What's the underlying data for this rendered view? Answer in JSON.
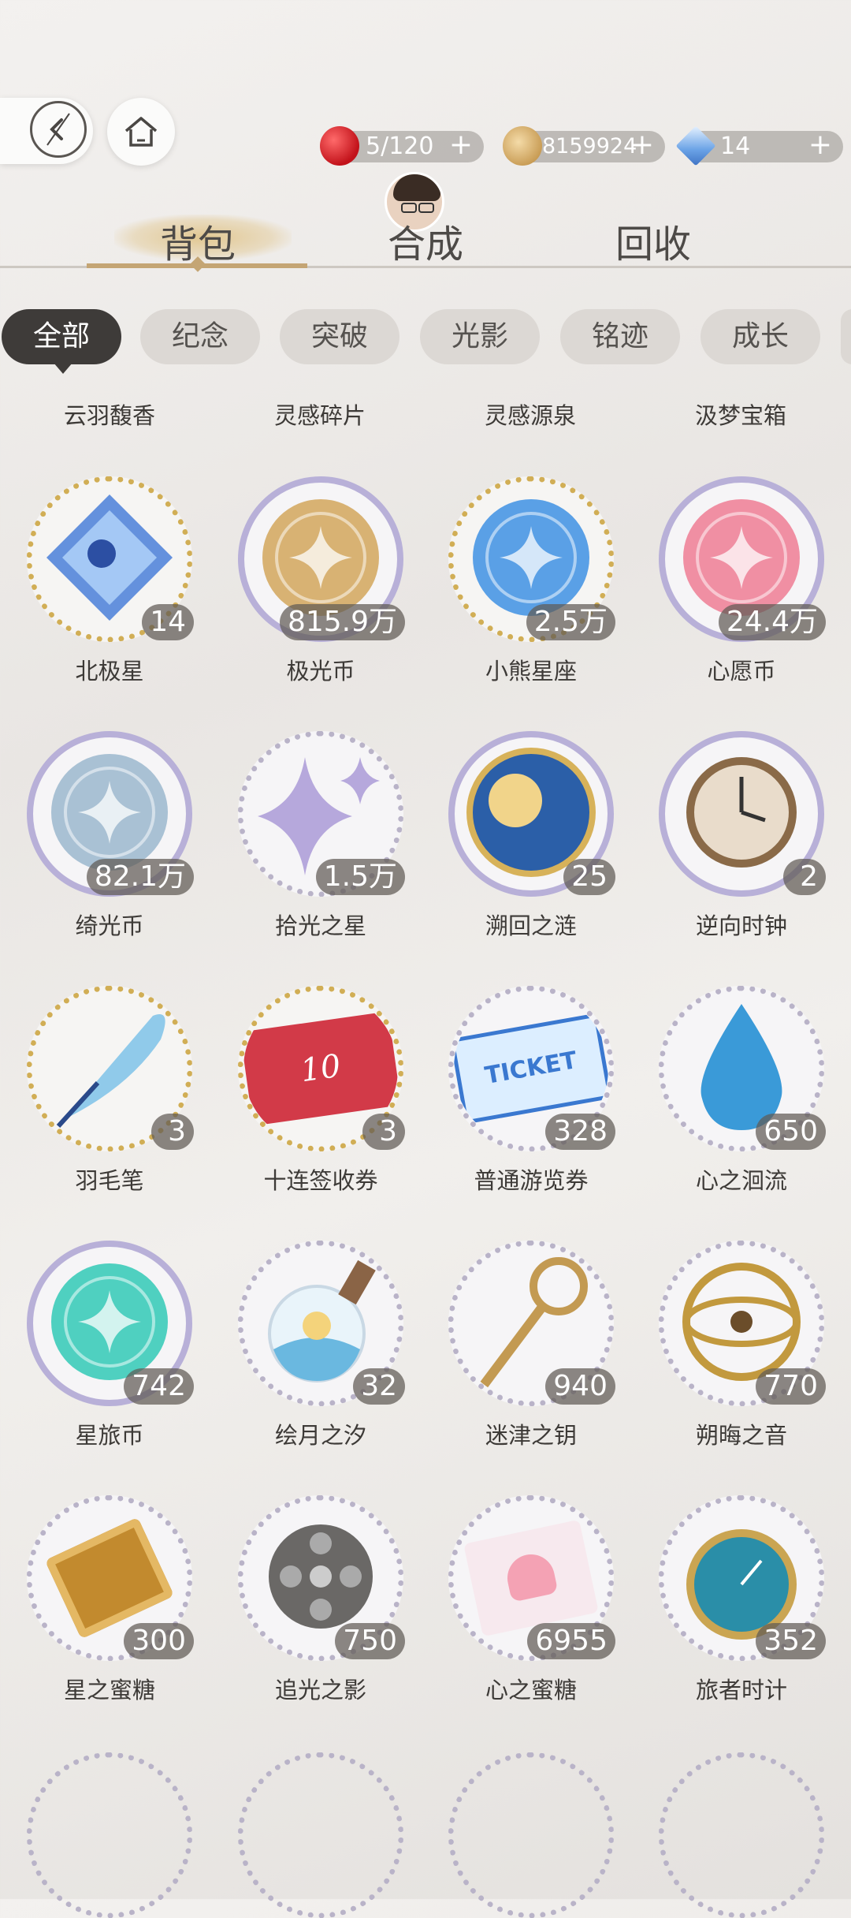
{
  "header": {
    "back_label": "",
    "home_label": "",
    "currencies": [
      {
        "name": "apple",
        "value": "5/120",
        "plus": "+",
        "color": "#d8262a"
      },
      {
        "name": "coin",
        "value": "8159924",
        "plus": "+",
        "color": "#d8b273"
      },
      {
        "name": "diamond",
        "value": "14",
        "plus": "+",
        "color": "#7fb1e8"
      }
    ]
  },
  "main_tabs": [
    {
      "label": "背包",
      "active": true
    },
    {
      "label": "合成",
      "active": false
    },
    {
      "label": "回收",
      "active": false
    }
  ],
  "sub_tabs": [
    {
      "label": "全部",
      "active": true
    },
    {
      "label": "纪念",
      "active": false
    },
    {
      "label": "突破",
      "active": false
    },
    {
      "label": "光影",
      "active": false
    },
    {
      "label": "铭迹",
      "active": false
    },
    {
      "label": "成长",
      "active": false
    }
  ],
  "top_row_names": [
    "云羽馥香",
    "灵感碎片",
    "灵感源泉",
    "汲梦宝箱"
  ],
  "items": [
    {
      "name": "北极星",
      "count": "14",
      "ring": "gold",
      "icon": "polaris-crystal-icon",
      "color": "#4a7fd8"
    },
    {
      "name": "极光币",
      "count": "815.9万",
      "ring": "purple",
      "icon": "aurora-coin-icon",
      "color": "#d8b273"
    },
    {
      "name": "小熊星座",
      "count": "2.5万",
      "ring": "gold",
      "icon": "ursa-minor-coin-icon",
      "color": "#5aa0e6"
    },
    {
      "name": "心愿币",
      "count": "24.4万",
      "ring": "purple",
      "icon": "wish-coin-icon",
      "color": "#f08fa3"
    },
    {
      "name": "绮光币",
      "count": "82.1万",
      "ring": "purple",
      "icon": "radiance-coin-icon",
      "color": "#a9c1d4"
    },
    {
      "name": "拾光之星",
      "count": "1.5万",
      "ring": "silver",
      "icon": "star-sparkle-icon",
      "color": "#b6a8dc"
    },
    {
      "name": "溯回之涟",
      "count": "25",
      "ring": "purple",
      "icon": "sun-moon-medallion-icon",
      "color": "#2b5fa8"
    },
    {
      "name": "逆向时钟",
      "count": "2",
      "ring": "purple",
      "icon": "reverse-clock-icon",
      "color": "#8a6a48"
    },
    {
      "name": "羽毛笔",
      "count": "3",
      "ring": "gold",
      "icon": "quill-pen-icon",
      "color": "#7ec2e8"
    },
    {
      "name": "十连签收券",
      "count": "3",
      "ring": "gold",
      "icon": "ten-pull-ticket-icon",
      "color": "#d23a48"
    },
    {
      "name": "普通游览券",
      "count": "328",
      "ring": "silver",
      "icon": "tour-ticket-icon",
      "color": "#3a78d0"
    },
    {
      "name": "心之洄流",
      "count": "650",
      "ring": "silver",
      "icon": "water-drop-icon",
      "color": "#3a9ad8"
    },
    {
      "name": "星旅币",
      "count": "742",
      "ring": "purple",
      "icon": "star-travel-coin-icon",
      "color": "#4fd0c0"
    },
    {
      "name": "绘月之汐",
      "count": "32",
      "ring": "silver",
      "icon": "moon-bottle-icon",
      "color": "#6ab8e0"
    },
    {
      "name": "迷津之钥",
      "count": "940",
      "ring": "silver",
      "icon": "golden-key-icon",
      "color": "#c39a52"
    },
    {
      "name": "朔晦之音",
      "count": "770",
      "ring": "silver",
      "icon": "armillary-sphere-icon",
      "color": "#c2993e"
    },
    {
      "name": "星之蜜糖",
      "count": "300",
      "ring": "silver",
      "icon": "star-candy-icon",
      "color": "#c28a2e"
    },
    {
      "name": "追光之影",
      "count": "750",
      "ring": "silver",
      "icon": "film-reel-icon",
      "color": "#6a6866"
    },
    {
      "name": "心之蜜糖",
      "count": "6955",
      "ring": "silver",
      "icon": "heart-candy-icon",
      "color": "#f4a2b4"
    },
    {
      "name": "旅者时计",
      "count": "352",
      "ring": "silver",
      "icon": "pocket-watch-icon",
      "color": "#2a8ea8"
    }
  ],
  "watermark_text": "",
  "bottom_row_icons": [
    "card-icon",
    "card-icon",
    "card-icon",
    "light-card-icon"
  ]
}
